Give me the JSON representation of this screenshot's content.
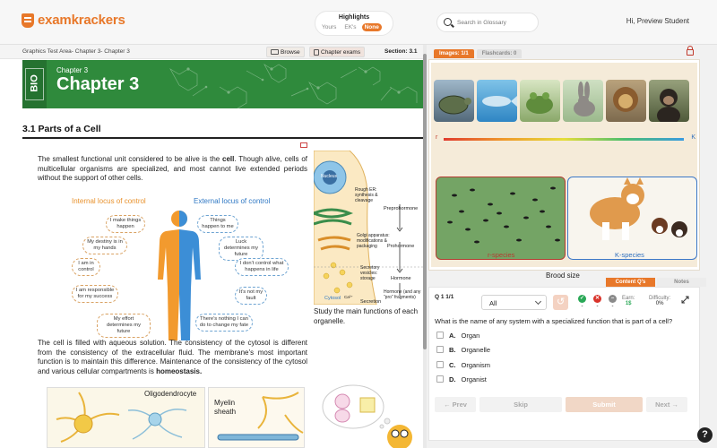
{
  "header": {
    "logo_text": "examkrackers",
    "highlights_label": "Highlights",
    "highlight_options": [
      "Yours",
      "EK's",
      "None"
    ],
    "highlight_selected": "None",
    "search_placeholder": "Search in Glossary",
    "greeting": "Hi, Preview Student"
  },
  "reader": {
    "breadcrumb": "Graphics Test Area- Chapter 3- Chapter 3",
    "browse_label": "Browse",
    "chapter_exams_label": "Chapter exams",
    "section_label": "Section: 3.1",
    "bio_badge": "BIO",
    "chapter_small": "Chapter 3",
    "chapter_big": "Chapter 3",
    "section_title": "3.1 Parts of a Cell",
    "para1_a": "The smallest functional unit considered to be alive is the ",
    "para1_b": "cell",
    "para1_c": ". Though alive, cells of multicellular organisms are specialized, and most cannot live extended periods without the support of other cells.",
    "para2_a": "The cell is filled with aqueous solution. The consistency of the cytosol is different from the consistency of the extracellular fluid. The membrane’s most important function is to maintain this difference. Maintenance of the consistency of the cytosol and various cellular compartments is ",
    "para2_b": "homeostasis.",
    "cell_caption": "Study the main functions of each organelle.",
    "locus": {
      "internal_title": "Internal locus of control",
      "external_title": "External locus of control",
      "internal": [
        "I make things happen",
        "My destiny is in my hands",
        "I am in control",
        "I am responsible for my success",
        "My effort determines my future"
      ],
      "external": [
        "Things happen to me",
        "Luck determines my future",
        "I don’t control what happens in life",
        "It’s not my fault",
        "There’s nothing I can do to change my fate"
      ]
    },
    "cell_labels": {
      "nucleus": "Nucleus",
      "rough_er": "Rough ER: synthesis & cleavage",
      "preprohormone": "Preprohormone",
      "golgi": "Golgi apparatus: modifications & packaging",
      "prohormone": "Prohormone",
      "secretory": "Secretory vesicles: storage",
      "hormone": "Hormone",
      "hormone_pro": "Hormone (and any “pro” fragments)",
      "cytosol": "Cytosol",
      "secretion": "Secretion",
      "ca": "Ca²⁺"
    },
    "neuron_label": "Oligodendrocyte",
    "myelin_label": "Myelin sheath"
  },
  "images_panel": {
    "tab_images": "Images: 1/1",
    "tab_flashcards": "Flashcards: 0",
    "r_label": "r",
    "k_label": "K",
    "r_species": "r-species",
    "k_species": "K-species",
    "caption": "Brood size"
  },
  "question_panel": {
    "tab_content": "Content Q's",
    "tab_notes": "Notes",
    "q_number": "Q 1 1/1",
    "filter_value": "All",
    "correct_count": "-",
    "incorrect_count": "-",
    "skipped_count": "-",
    "earn_label": "Earn:",
    "earn_value": "1$",
    "difficulty_label": "Difficulty:",
    "difficulty_value": "0%",
    "question": "What is the name of any system with a specialized function that is part of a cell?",
    "choices": [
      {
        "letter": "A.",
        "text": "Organ"
      },
      {
        "letter": "B.",
        "text": "Organelle"
      },
      {
        "letter": "C.",
        "text": "Organism"
      },
      {
        "letter": "D.",
        "text": "Organist"
      }
    ],
    "prev_label": "Prev",
    "skip_label": "Skip",
    "submit_label": "Submit",
    "next_label": "Next"
  },
  "help_label": "?"
}
